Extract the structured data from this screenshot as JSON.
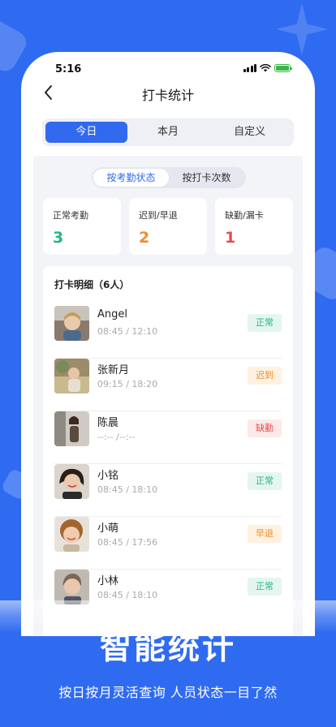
{
  "status_bar": {
    "time": "5:16"
  },
  "nav": {
    "title": "打卡统计"
  },
  "date_tabs": [
    {
      "label": "今日",
      "active": true
    },
    {
      "label": "本月",
      "active": false
    },
    {
      "label": "自定义",
      "active": false
    }
  ],
  "view_toggle": [
    {
      "label": "按考勤状态",
      "active": true
    },
    {
      "label": "按打卡次数",
      "active": false
    }
  ],
  "stats": [
    {
      "label": "正常考勤",
      "value": "3",
      "color": "#24b684"
    },
    {
      "label": "迟到/早退",
      "value": "2",
      "color": "#f08c2c"
    },
    {
      "label": "缺勤/漏卡",
      "value": "1",
      "color": "#e84c4c"
    }
  ],
  "list": {
    "title": "打卡明细（6人）",
    "items": [
      {
        "name": "Angel",
        "time": "08:45 / 12:10",
        "status": "正常",
        "status_type": "normal"
      },
      {
        "name": "张新月",
        "time": "09:15 / 18:20",
        "status": "迟到",
        "status_type": "late"
      },
      {
        "name": "陈晨",
        "time": "--:-- /--:--",
        "status": "缺勤",
        "status_type": "absent"
      },
      {
        "name": "小铭",
        "time": "08:45 / 18:10",
        "status": "正常",
        "status_type": "normal"
      },
      {
        "name": "小萌",
        "time": "08:45 / 17:56",
        "status": "早退",
        "status_type": "late"
      },
      {
        "name": "小林",
        "time": "08:45 / 18:10",
        "status": "正常",
        "status_type": "normal"
      }
    ]
  },
  "promo": {
    "title": "智能统计",
    "subtitle": "按日按月灵活查询 人员状态一目了然"
  },
  "colors": {
    "background": "#2f6bf0",
    "accent": "#3169ef"
  }
}
